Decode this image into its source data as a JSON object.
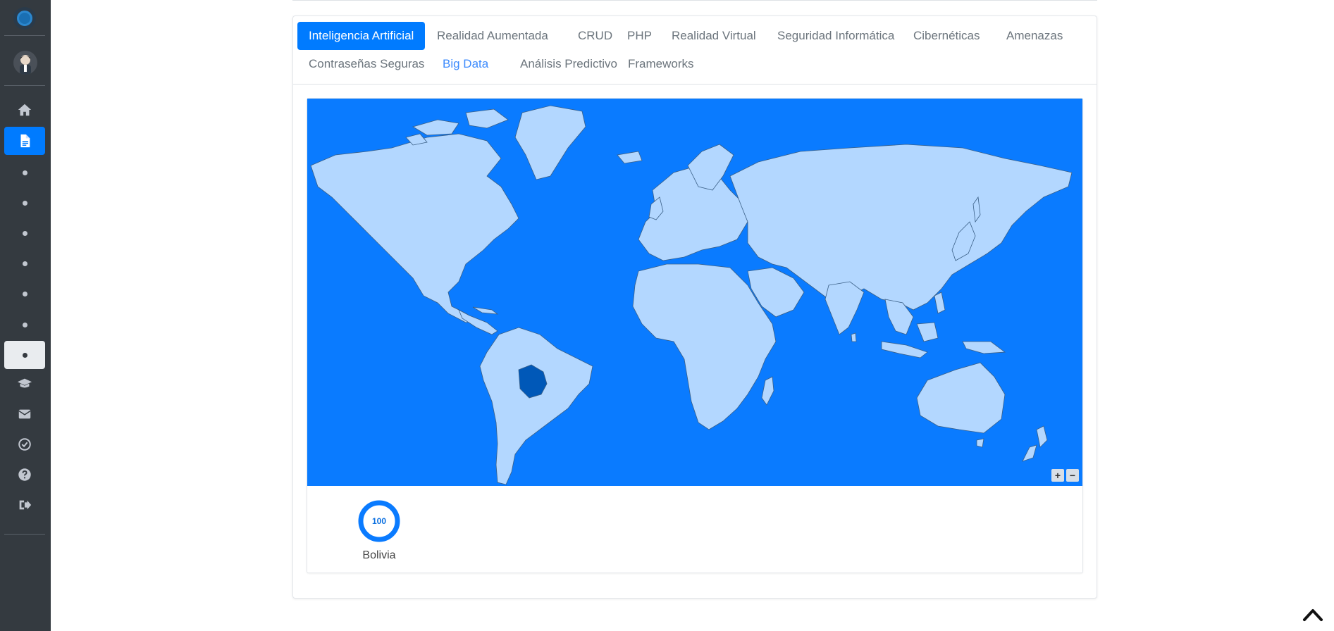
{
  "sidebar": {
    "items": [
      {
        "icon": "home-icon"
      },
      {
        "icon": "document-icon"
      },
      {
        "icon": "dot-icon"
      },
      {
        "icon": "dot-icon"
      },
      {
        "icon": "dot-icon"
      },
      {
        "icon": "dot-icon"
      },
      {
        "icon": "dot-icon"
      },
      {
        "icon": "dot-icon"
      },
      {
        "icon": "dot-icon"
      },
      {
        "icon": "graduation-cap-icon"
      },
      {
        "icon": "envelope-icon"
      },
      {
        "icon": "check-circle-icon"
      },
      {
        "icon": "question-circle-icon"
      },
      {
        "icon": "sign-out-icon"
      }
    ]
  },
  "tabs": [
    {
      "label": "Inteligencia Artificial"
    },
    {
      "label": "Realidad Aumentada"
    },
    {
      "label": "CRUD"
    },
    {
      "label": "PHP"
    },
    {
      "label": "Realidad Virtual"
    },
    {
      "label": "Seguridad Informática"
    },
    {
      "label": "Cibernéticas"
    },
    {
      "label": "Amenazas"
    },
    {
      "label": "Contraseñas Seguras"
    },
    {
      "label": "Big Data"
    },
    {
      "label": "Análisis Predictivo"
    },
    {
      "label": "Frameworks"
    }
  ],
  "map": {
    "highlighted_country": "Bolivia",
    "ocean_color": "#0a7bff",
    "land_color": "#b3d7ff",
    "highlight_color": "#0058b8",
    "zoom_in_label": "+",
    "zoom_out_label": "−"
  },
  "stats": [
    {
      "country": "Bolivia",
      "value": "100"
    }
  ]
}
